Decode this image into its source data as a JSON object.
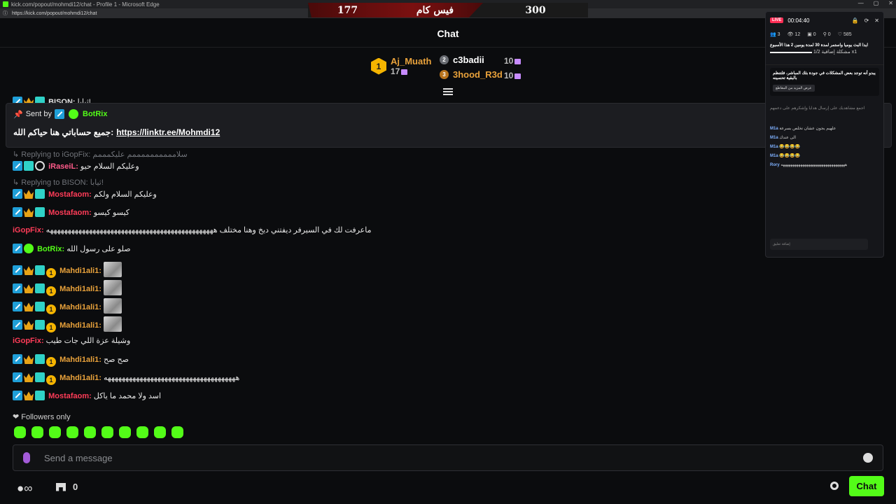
{
  "window": {
    "title": "kick.com/popout/mohmdi12/chat - Profile 1 - Microsoft Edge",
    "url": "https://kick.com/popout/mohmdi12/chat"
  },
  "score": {
    "left_value": "177",
    "left_label": "فيس كام",
    "right_value": "300"
  },
  "chat_title": "Chat",
  "leaderboard": {
    "first": {
      "rank": "1",
      "name": "Aj_Muath",
      "count": "17"
    },
    "others": [
      {
        "rank": "2",
        "name": "c3badii",
        "count": "10",
        "color": "#ffffff"
      },
      {
        "rank": "3",
        "name": "3hood_R3d",
        "count": "10",
        "color": "#e9a23b"
      }
    ]
  },
  "pinned": {
    "sent_by_label": "Sent by",
    "sender": "BotRix",
    "text": "جميع حساباتي هنا حياكم الله:",
    "link": "https://linktr.ee/Mohmdi12"
  },
  "messages": [
    {
      "type": "reply",
      "text": "Replying to iGopFix: سلاممممممممممم عليكمممم"
    },
    {
      "user": "iRaseiL:",
      "text": "وعليكم السلام حيو"
    },
    {
      "type": "reply",
      "text": "Replying to BISON: ثيابا!"
    },
    {
      "user": "Mostafaom:",
      "text": "وعليكم السلام ولكم"
    },
    {
      "user": "Mostafaom:",
      "text": "كيسو كيسو"
    },
    {
      "user": "iGopFix:",
      "text": "ماعرفت لك في السيرفر ديفتني ديخ وهنا مختلف هههههههههههههههههههههههههههههههههههههههههههههههه"
    },
    {
      "user": "BotRix:",
      "text": "صلو على رسول الله"
    },
    {
      "user": "Mahdi1ali1:",
      "text": ""
    },
    {
      "user": "Mahdi1ali1:",
      "text": ""
    },
    {
      "user": "Mahdi1ali1:",
      "text": ""
    },
    {
      "user": "Mahdi1ali1:",
      "text": ""
    },
    {
      "user": "iGopFix:",
      "text": "وشيلة عزة اللي جات طيب"
    },
    {
      "user": "Mahdi1ali1:",
      "text": "صح صح"
    },
    {
      "user": "Mahdi1ali1:",
      "text": "هههههههههههههههههههههههههههههههههههههه"
    },
    {
      "user": "Mostafaom:",
      "text": "اسد ولا محمد ما ياكل"
    }
  ],
  "partial_top_user": "BISON:",
  "partial_top_text": "ثيابا!",
  "followers_only": "Followers only",
  "input": {
    "placeholder": "Send a message"
  },
  "bottom": {
    "store_count": "0",
    "chat_button": "Chat"
  },
  "widget": {
    "live": "LIVE",
    "timer": "00:04:40",
    "stats": [
      "3",
      "12",
      "0",
      "0",
      "585"
    ],
    "poll_question": "ايدا البث يوميا واستمر لمدة 30 لمدة يومين 2 هذا الأسبوع",
    "poll_progress": "1/2",
    "poll_tag": "مشكلة إضافية",
    "poll_multiplier": "x1",
    "notice_text": "يبدو أنه توجد بعض المشكلات في جودة بثك المباشر، فلتنظم بالبقية تحسينه",
    "notice_button": "عرض المزيد من المقاطع",
    "hint": "اجمع مشاهديك على إرسال هدايا وإشكرهم على دعمهم",
    "chat": [
      {
        "name": "M1a",
        "text": "علهيم يجون عشان تخلص بسرعة"
      },
      {
        "name": "M1a",
        "text": "الى عندك"
      },
      {
        "name": "M1a",
        "text": "😂😂😂😂"
      },
      {
        "name": "M1a",
        "text": "😂😂😂😂"
      },
      {
        "name": "Rory",
        "text": "هههههههههههههههههههههههههههههههههه"
      }
    ],
    "input_placeholder": "إضافة تعليق"
  }
}
